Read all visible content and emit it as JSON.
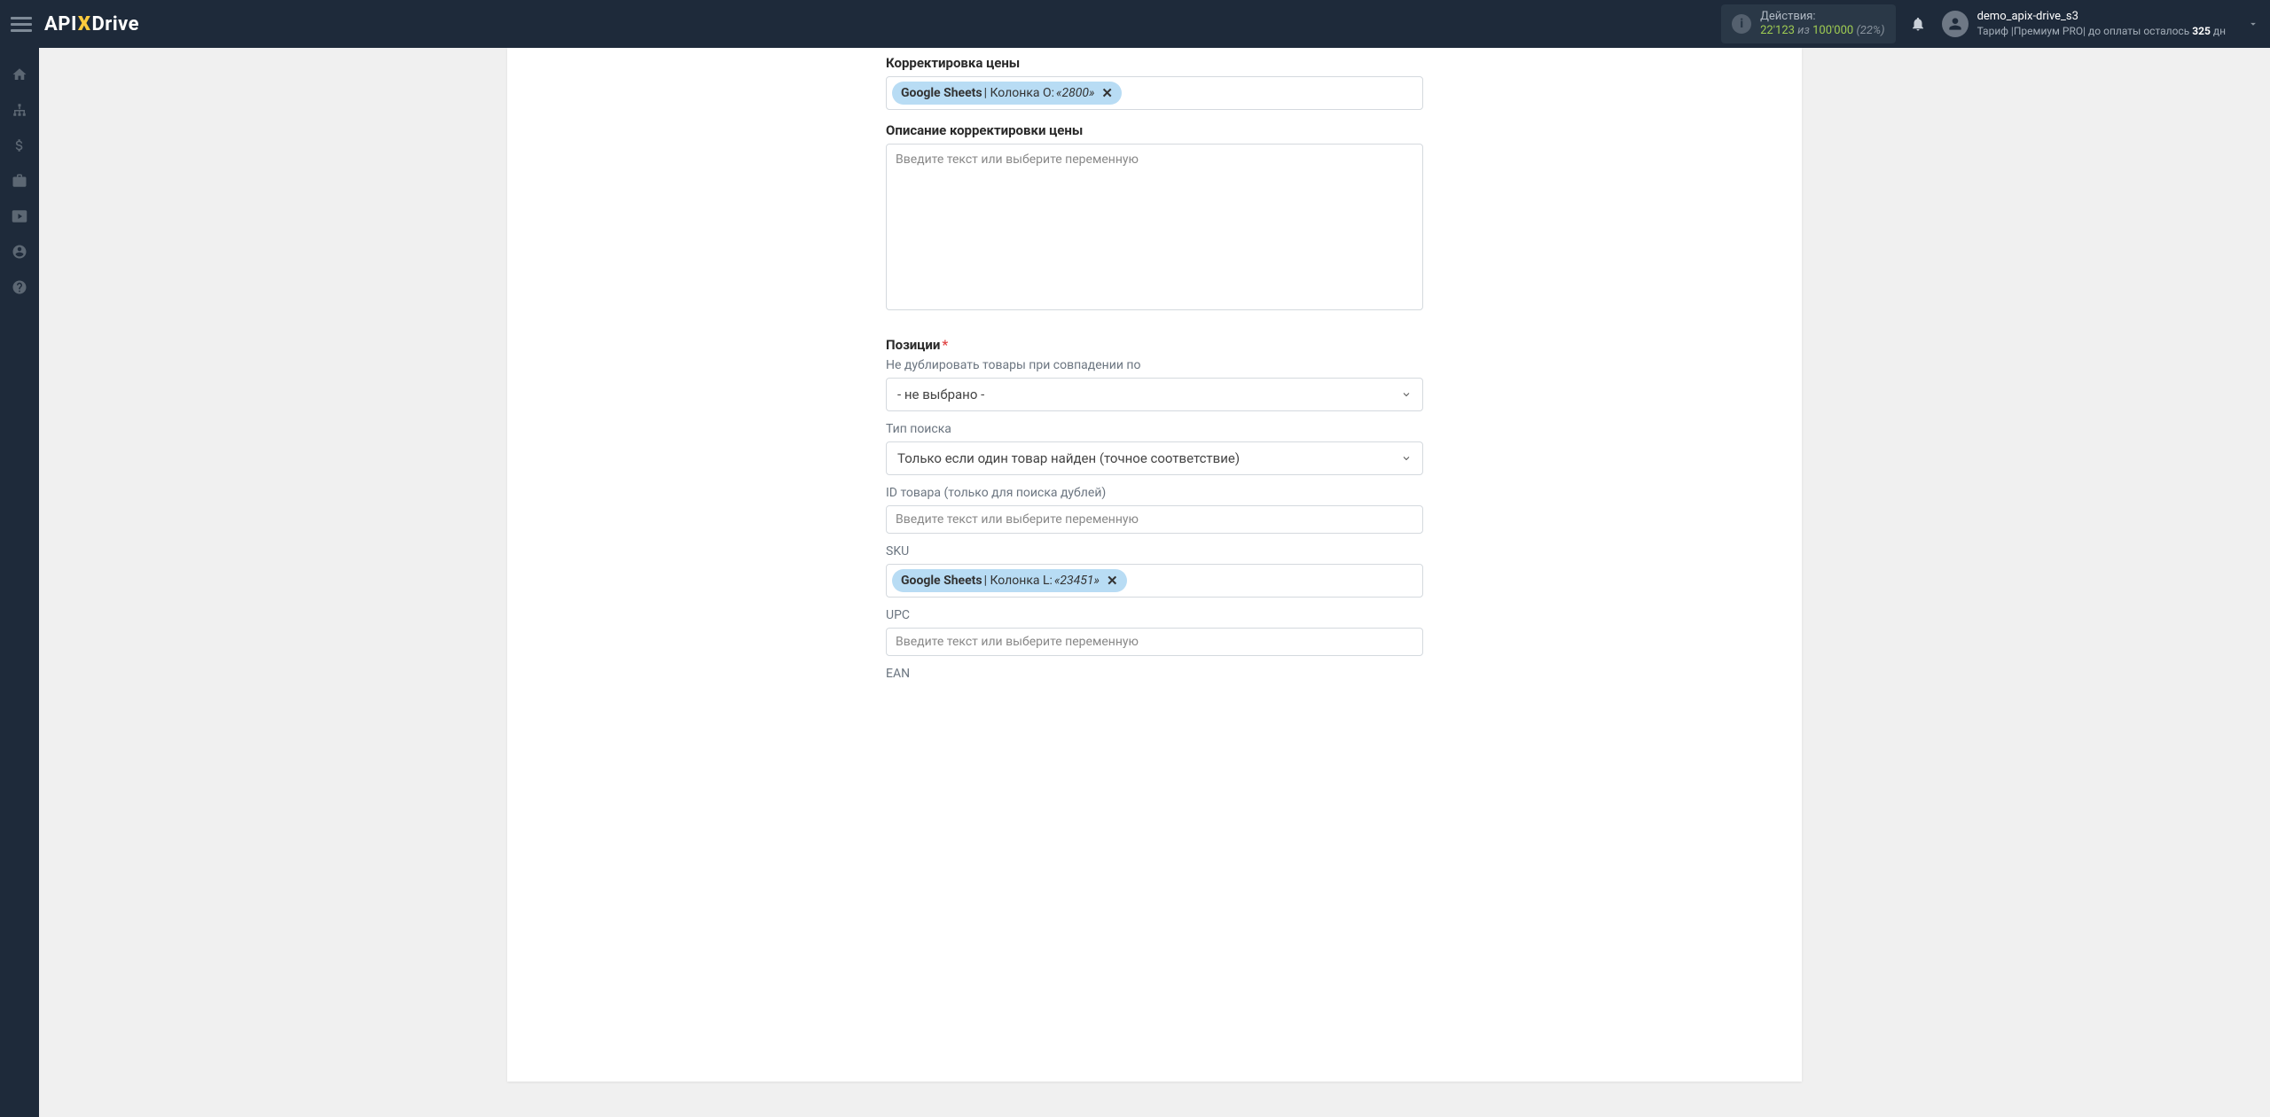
{
  "topbar": {
    "logo": {
      "api": "API",
      "x": "X",
      "drive": "Drive"
    },
    "actions": {
      "label": "Действия:",
      "used": "22'123",
      "of_word": "из",
      "limit": "100'000",
      "percent": "(22%)"
    },
    "user": {
      "name": "demo_apix-drive_s3",
      "plan_prefix": "Тариф |",
      "plan_name": "Премиум PRO",
      "plan_mid": "|  до оплаты осталось ",
      "days": "325",
      "days_suffix": " дн"
    }
  },
  "form": {
    "price_adj": {
      "label": "Корректировка цены",
      "tag": {
        "source": "Google Sheets",
        "sep": " | ",
        "col": "Колонка O: ",
        "val": "«2800»"
      }
    },
    "price_adj_desc": {
      "label": "Описание корректировки цены",
      "placeholder": "Введите текст или выберите переменную"
    },
    "positions": {
      "label": "Позиции"
    },
    "no_dup": {
      "label": "Не дублировать товары при совпадении по",
      "value": "- не выбрано -"
    },
    "search_type": {
      "label": "Тип поиска",
      "value": "Только если один товар найден (точное соответствие)"
    },
    "product_id": {
      "label": "ID товара (только для поиска дублей)",
      "placeholder": "Введите текст или выберите переменную"
    },
    "sku": {
      "label": "SKU",
      "tag": {
        "source": "Google Sheets",
        "sep": " | ",
        "col": "Колонка L: ",
        "val": "«23451»"
      }
    },
    "upc": {
      "label": "UPC",
      "placeholder": "Введите текст или выберите переменную"
    },
    "ean": {
      "label": "EAN"
    }
  }
}
